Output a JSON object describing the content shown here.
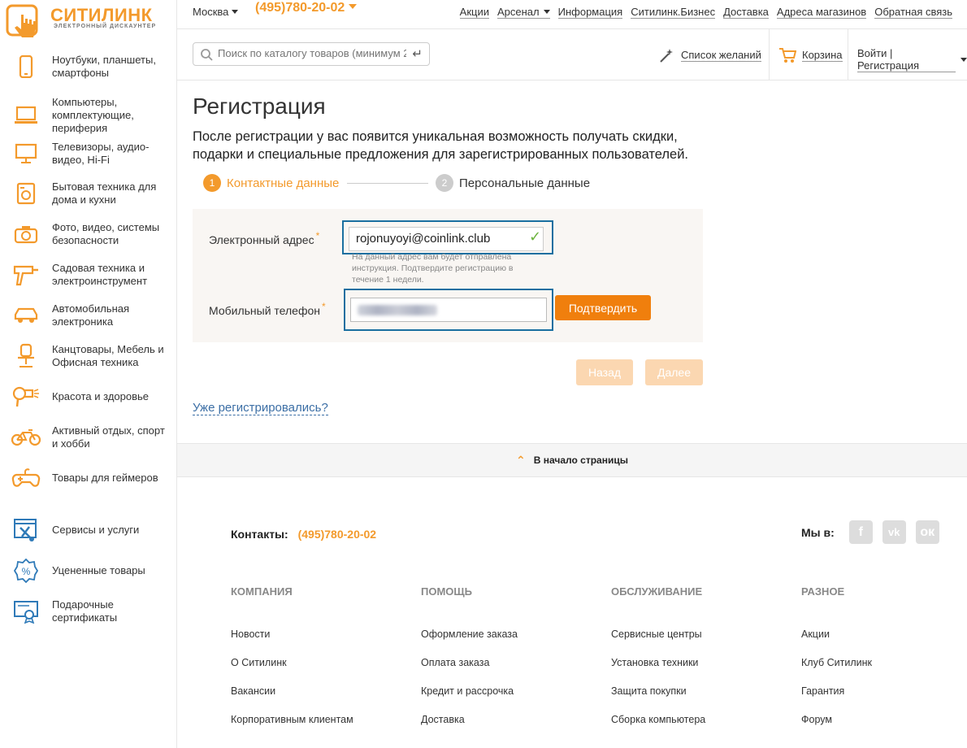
{
  "brand": {
    "name": "СИТИЛИНК",
    "tagline": "ЭЛЕКТРОННЫЙ ДИСКАУНТЕР",
    "accent": "#f39a2c"
  },
  "sidebar": {
    "items": [
      {
        "label": "Ноутбуки, планшеты, смартфоны",
        "icon": "smartphone-icon"
      },
      {
        "label": "Компьютеры, комплектующие, периферия",
        "icon": "laptop-icon"
      },
      {
        "label": "Телевизоры, аудио-видео, Hi-Fi",
        "icon": "monitor-icon"
      },
      {
        "label": "Бытовая техника для дома и кухни",
        "icon": "washing-machine-icon"
      },
      {
        "label": "Фото, видео, системы безопасности",
        "icon": "camera-icon"
      },
      {
        "label": "Садовая техника и электроинструмент",
        "icon": "drill-icon"
      },
      {
        "label": "Автомобильная электроника",
        "icon": "car-icon"
      },
      {
        "label": "Канцтовары, Мебель и Офисная техника",
        "icon": "office-chair-icon"
      },
      {
        "label": "Красота и здоровье",
        "icon": "hair-dryer-icon"
      },
      {
        "label": "Активный отдых, спорт и хобби",
        "icon": "bicycle-icon"
      },
      {
        "label": "Товары для геймеров",
        "icon": "gamepad-icon"
      },
      {
        "label": "Сервисы и услуги",
        "icon": "service-tools-icon"
      },
      {
        "label": "Уцененные товары",
        "icon": "discount-badge-icon"
      },
      {
        "label": "Подарочные сертификаты",
        "icon": "certificate-icon"
      }
    ]
  },
  "topbar": {
    "city": "Москва",
    "phone": "(495)780-20-02",
    "links": [
      "Акции",
      "Арсенал",
      "Информация",
      "Ситилинк.Бизнес",
      "Доставка",
      "Адреса магазинов",
      "Обратная связь"
    ]
  },
  "header": {
    "search_placeholder": "Поиск по каталогу товаров (минимум 2",
    "wishlist": "Список желаний",
    "cart": "Корзина",
    "login": "Войти | Регистрация"
  },
  "page": {
    "title": "Регистрация",
    "intro": "После регистрации у вас появится уникальная возможность получать скидки, подарки и специальные предложения для зарегистрированных пользователей.",
    "steps": [
      {
        "num": "1",
        "label": "Контактные данные"
      },
      {
        "num": "2",
        "label": "Персональные данные"
      }
    ],
    "form": {
      "email_label": "Электронный адрес",
      "email_value": "rojonuyoyi@coinlink.club",
      "email_hint": "На данный адрес вам будет отправлена инструкция. Подтвердите регистрацию в течение 1 недели.",
      "phone_label": "Мобильный телефон",
      "required_mark": "*",
      "check_mark": "✓",
      "confirm_button": "Подтвердить"
    },
    "back_button": "Назад",
    "next_button": "Далее",
    "already_registered": "Уже регистрировались?",
    "to_top": "В начало страницы"
  },
  "footer": {
    "contacts_label": "Контакты:",
    "contacts_phone": "(495)780-20-02",
    "social_label": "Мы в:",
    "columns": [
      {
        "heading": "КОМПАНИЯ",
        "links": [
          "Новости",
          "О Ситилинк",
          "Вакансии",
          "Корпоративным клиентам"
        ]
      },
      {
        "heading": "ПОМОЩЬ",
        "links": [
          "Оформление заказа",
          "Оплата заказа",
          "Кредит и рассрочка",
          "Доставка"
        ]
      },
      {
        "heading": "ОБСЛУЖИВАНИЕ",
        "links": [
          "Сервисные центры",
          "Установка техники",
          "Защита покупки",
          "Сборка компьютера"
        ]
      },
      {
        "heading": "РАЗНОЕ",
        "links": [
          "Акции",
          "Клуб Ситилинк",
          "Гарантия",
          "Форум"
        ]
      }
    ]
  }
}
